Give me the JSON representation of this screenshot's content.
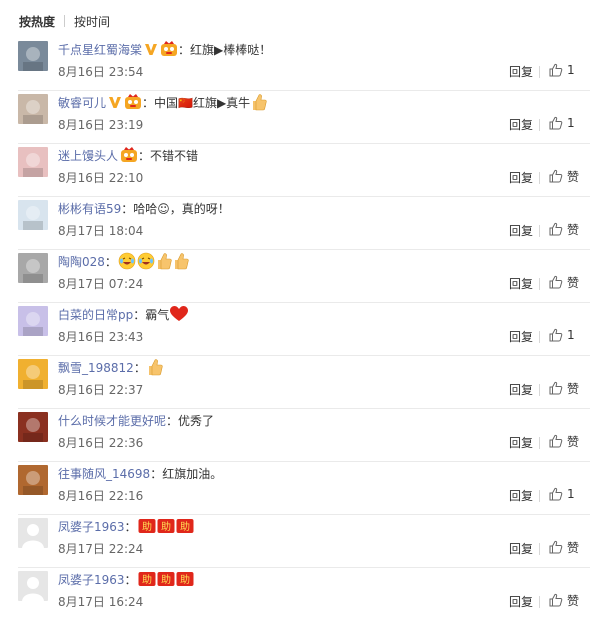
{
  "sort": {
    "hot": "按热度",
    "time": "按时间"
  },
  "comments": [
    {
      "user": "千点星红蜀海棠",
      "verified": true,
      "vip": true,
      "text": "：红旗▶棒棒哒！",
      "emoji": [],
      "time": "8月16日 23:54",
      "reply": "回复",
      "likes": "1",
      "avatar_color": "#7a8a9a"
    },
    {
      "user": "敏睿可儿",
      "verified": true,
      "vip": true,
      "text": "：中国🇨🇳红旗▶真牛",
      "emoji": [
        "thumb"
      ],
      "time": "8月16日 23:19",
      "reply": "回复",
      "likes": "1",
      "avatar_color": "#c9b8a8"
    },
    {
      "user": "迷上馒头人",
      "verified": false,
      "vip": true,
      "text": "：不错不错",
      "emoji": [],
      "time": "8月16日 22:10",
      "reply": "回复",
      "likes": "赞",
      "avatar_color": "#e8c0c0"
    },
    {
      "user": "彬彬有语59",
      "verified": false,
      "vip": false,
      "text": "：哈哈☺，真的呀！",
      "emoji": [],
      "time": "8月17日 18:04",
      "reply": "回复",
      "likes": "赞",
      "avatar_color": "#d8e4ee"
    },
    {
      "user": "陶陶028",
      "verified": false,
      "vip": false,
      "text": "：",
      "emoji": [
        "laugh",
        "laugh",
        "thumb",
        "thumb"
      ],
      "time": "8月17日 07:24",
      "reply": "回复",
      "likes": "赞",
      "avatar_color": "#a8a8a8"
    },
    {
      "user": "白菜的日常pp",
      "verified": false,
      "vip": false,
      "text": "：霸气",
      "emoji": [
        "heart"
      ],
      "time": "8月16日 23:43",
      "reply": "回复",
      "likes": "1",
      "avatar_color": "#c8c0e8"
    },
    {
      "user": "飘雪_198812",
      "verified": false,
      "vip": false,
      "text": "：",
      "emoji": [
        "thumb"
      ],
      "time": "8月16日 22:37",
      "reply": "回复",
      "likes": "赞",
      "avatar_color": "#f0b030"
    },
    {
      "user": "什么时候才能更好呢",
      "verified": false,
      "vip": false,
      "text": "：优秀了",
      "emoji": [],
      "time": "8月16日 22:36",
      "reply": "回复",
      "likes": "赞",
      "avatar_color": "#8a3020"
    },
    {
      "user": "往事随风_14698",
      "verified": false,
      "vip": false,
      "text": "：红旗加油。",
      "emoji": [],
      "time": "8月16日 22:16",
      "reply": "回复",
      "likes": "1",
      "avatar_color": "#b06830"
    },
    {
      "user": "凤婆子1963",
      "verified": false,
      "vip": false,
      "text": "：",
      "emoji": [
        "stamp",
        "stamp",
        "stamp"
      ],
      "time": "8月17日 22:24",
      "reply": "回复",
      "likes": "赞",
      "avatar_color": "#e0e0e0"
    },
    {
      "user": "凤婆子1963",
      "verified": false,
      "vip": false,
      "text": "：",
      "emoji": [
        "stamp",
        "stamp",
        "stamp"
      ],
      "time": "8月17日 16:24",
      "reply": "回复",
      "likes": "赞",
      "avatar_color": "#e0e0e0"
    }
  ],
  "colors": {
    "username": "#5b6da9",
    "orange": "#f5a623",
    "red": "#e0271b"
  }
}
